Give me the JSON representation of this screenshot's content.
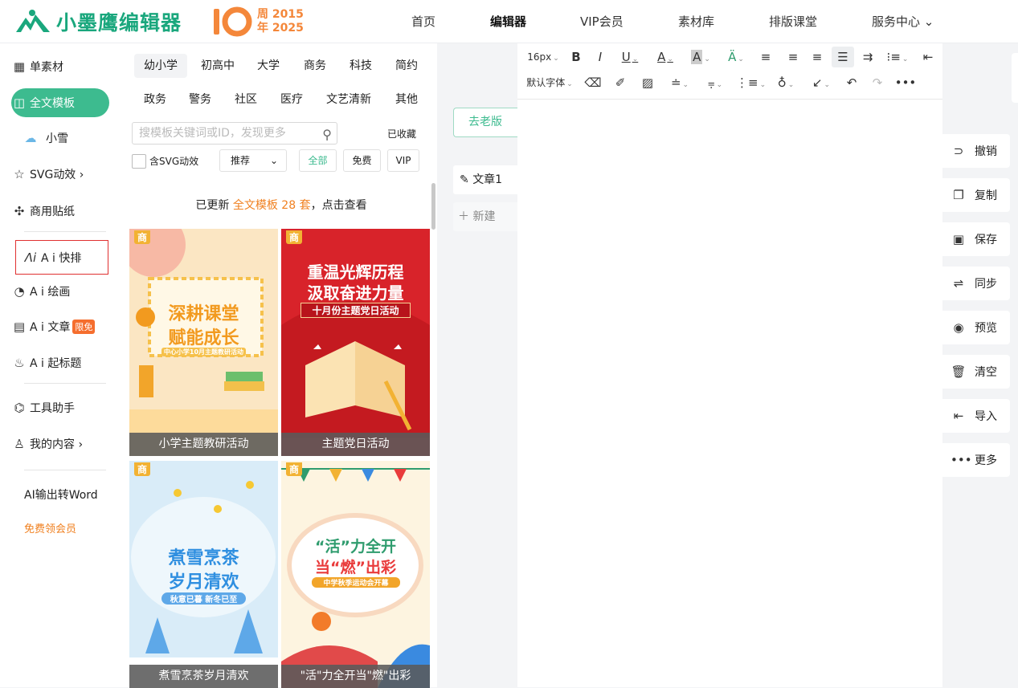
{
  "header": {
    "logo_text": "小墨鹰编辑器",
    "anniversary": {
      "ten": "10",
      "line1": "周 2015",
      "line2": "年 2025"
    },
    "nav": [
      {
        "label": "首页",
        "active": false
      },
      {
        "label": "编辑器",
        "active": true
      },
      {
        "label": "VIP会员",
        "active": false
      },
      {
        "label": "素材库",
        "active": false
      },
      {
        "label": "排版课堂",
        "active": false
      },
      {
        "label": "服务中心 ⌄",
        "active": false
      }
    ]
  },
  "sidebar": {
    "items": [
      {
        "label": "单素材",
        "icon": "grid-icon"
      },
      {
        "label": "全文模板",
        "icon": "template-icon",
        "active": true
      },
      {
        "label": "小雪",
        "icon": "cloud-icon"
      },
      {
        "label": "SVG动效 ›",
        "icon": "star-icon"
      },
      {
        "label": "商用贴纸",
        "icon": "puzzle-icon"
      },
      {
        "label": "A i 快排",
        "icon": "ai-icon"
      },
      {
        "label": "A i 绘画",
        "icon": "palette-icon"
      },
      {
        "label": "A i 文章",
        "icon": "doc-icon",
        "badge": "限免"
      },
      {
        "label": "A i 起标题",
        "icon": "flame-icon"
      },
      {
        "label": "工具助手",
        "icon": "tools-icon"
      },
      {
        "label": "我的内容 ›",
        "icon": "user-icon"
      }
    ],
    "ai_word": "AI输出转Word",
    "free_vip": "免费领会员"
  },
  "templates": {
    "categories_row1": [
      "幼小学",
      "初高中",
      "大学",
      "商务",
      "科技",
      "简约"
    ],
    "categories_row2": [
      "政务",
      "警务",
      "社区",
      "医疗",
      "文艺清新",
      "其他"
    ],
    "search_placeholder": "搜模板关键词或ID，发现更多",
    "collected": "已收藏",
    "svg_filter": "含SVG动效",
    "sort": "推荐",
    "sort_arrow": "⌄",
    "filters": [
      "全部",
      "免费",
      "VIP"
    ],
    "notice_prefix": "已更新 ",
    "notice_highlight": "全文模板 28 套",
    "notice_suffix": "，点击查看",
    "cards": [
      {
        "caption": "小学主题教研活动",
        "tag": "商",
        "title1": "深耕课堂",
        "title2": "赋能成长",
        "sub": "中心小学10月主题教研活动",
        "colors": {
          "bg": "#fbe6c3",
          "title": "#f29a1f"
        }
      },
      {
        "caption": "主题党日活动",
        "tag": "商",
        "title1": "重温光辉历程",
        "title2": "汲取奋进力量",
        "sub": "十月份主题党日活动",
        "colors": {
          "bg": "#d8232a",
          "title": "#ffffff"
        }
      },
      {
        "caption": "煮雪烹茶岁月清欢",
        "tag": "商",
        "title1": "煮雪烹茶",
        "title2": "岁月清欢",
        "sub": "秋意已暮 新冬已至",
        "colors": {
          "bg": "#d9ecf8",
          "title": "#2f8fe0"
        }
      },
      {
        "caption": "\"活\"力全开当\"燃\"出彩",
        "tag": "商",
        "title1": "“活”力全开",
        "title2": "当“燃”出彩",
        "sub": "中学秋季运动会开幕",
        "colors": {
          "bg": "#fdf4e0",
          "title": "#e93b3b"
        }
      }
    ]
  },
  "docs": {
    "old_version": "去老版",
    "doc_name": "文章1",
    "new_doc": "新建"
  },
  "editor_toolbar": {
    "font_size": "16px",
    "font_family": "默认字体"
  },
  "right_actions": [
    {
      "label": "撤销",
      "icon": "undo-icon",
      "glyph": "⊃"
    },
    {
      "label": "复制",
      "icon": "copy-icon",
      "glyph": "❐"
    },
    {
      "label": "保存",
      "icon": "save-icon",
      "glyph": "▣"
    },
    {
      "label": "同步",
      "icon": "sync-icon",
      "glyph": "⇌"
    },
    {
      "label": "预览",
      "icon": "eye-icon",
      "glyph": "◉"
    },
    {
      "label": "清空",
      "icon": "trash-icon",
      "glyph": "🗑"
    },
    {
      "label": "导入",
      "icon": "import-icon",
      "glyph": "⇤"
    },
    {
      "label": "更多",
      "icon": "more-icon",
      "glyph": "•••"
    }
  ]
}
